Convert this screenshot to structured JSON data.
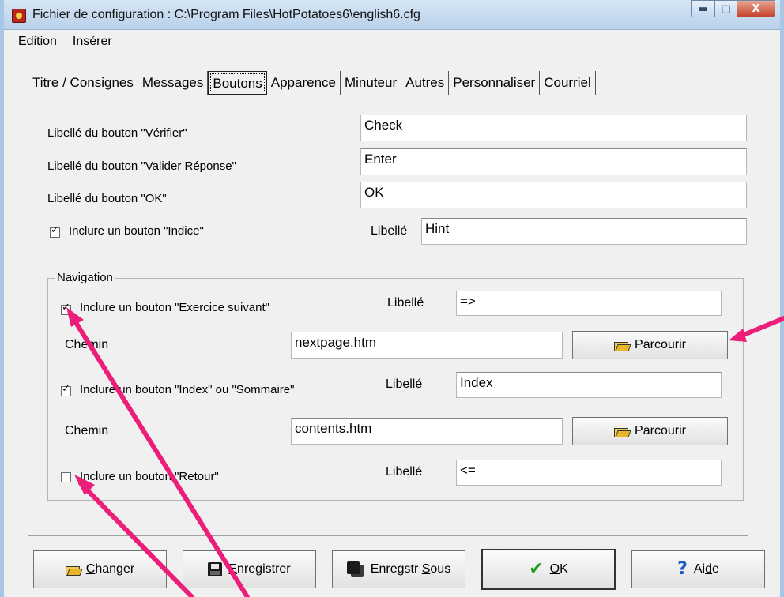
{
  "window": {
    "title": "Fichier de configuration : C:\\Program Files\\HotPotatoes6\\english6.cfg",
    "controls": {
      "minimize": "▬",
      "maximize": "□",
      "close": "X"
    }
  },
  "menu": {
    "items": [
      "Edition",
      "Insérer"
    ]
  },
  "tabs": [
    {
      "label": "Titre / Consignes",
      "active": false
    },
    {
      "label": "Messages",
      "active": false
    },
    {
      "label": "Boutons",
      "active": true
    },
    {
      "label": "Apparence",
      "active": false
    },
    {
      "label": "Minuteur",
      "active": false
    },
    {
      "label": "Autres",
      "active": false
    },
    {
      "label": "Personnaliser",
      "active": false
    },
    {
      "label": "Courriel",
      "active": false
    }
  ],
  "buttons_tab": {
    "check_label": "Libellé du bouton \"Vérifier\"",
    "check_value": "Check",
    "enter_label": "Libellé du bouton \"Valider Réponse\"",
    "enter_value": "Enter",
    "ok_label": "Libellé du bouton \"OK\"",
    "ok_value": "OK",
    "hint_checkbox": "Inclure un bouton \"Indice\"",
    "hint_checked": true,
    "hint_libelle": "Libellé",
    "hint_value": "Hint"
  },
  "navigation": {
    "title": "Navigation",
    "next": {
      "checkbox": "Inclure un bouton \"Exercice suivant\"",
      "checked": true,
      "libelle": "Libellé",
      "value": "=>",
      "path_label": "Chemin",
      "path_value": "nextpage.htm",
      "browse": "Parcourir"
    },
    "index": {
      "checkbox": "Inclure un bouton \"Index\" ou \"Sommaire\"",
      "checked": true,
      "libelle": "Libellé",
      "value": "Index",
      "path_label": "Chemin",
      "path_value": "contents.htm",
      "browse": "Parcourir"
    },
    "back": {
      "checkbox": "Inclure un bouton \"Retour\"",
      "checked": false,
      "libelle": "Libellé",
      "value": "<="
    }
  },
  "footer": {
    "change": {
      "underline": "C",
      "rest": "hanger"
    },
    "save": {
      "underline": "E",
      "rest": "nregistrer"
    },
    "save_as": {
      "before": "Enregstr ",
      "underline": "S",
      "rest": "ous"
    },
    "ok": {
      "underline": "O",
      "rest": "K"
    },
    "help": {
      "before": "Ai",
      "underline": "d",
      "rest": "e"
    }
  },
  "annotation": {
    "arrow_color": "#ec1e79"
  }
}
